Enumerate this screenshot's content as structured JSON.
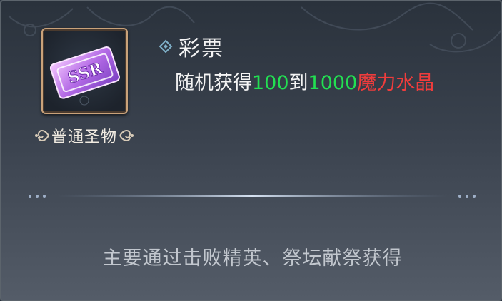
{
  "item": {
    "name": "彩票",
    "rarity": "普通圣物",
    "icon_text": "SSR",
    "icon": "ssr-ticket-icon",
    "description": {
      "prefix": "随机获得",
      "min": "100",
      "mid": "到",
      "max": "1000",
      "reward": "魔力水晶"
    },
    "source": "主要通过击败精英、祭坛献祭获得"
  },
  "colors": {
    "number": "#22e052",
    "reward": "#f03c3c",
    "text": "#f4f4f4",
    "frame": "#c9a27a"
  }
}
